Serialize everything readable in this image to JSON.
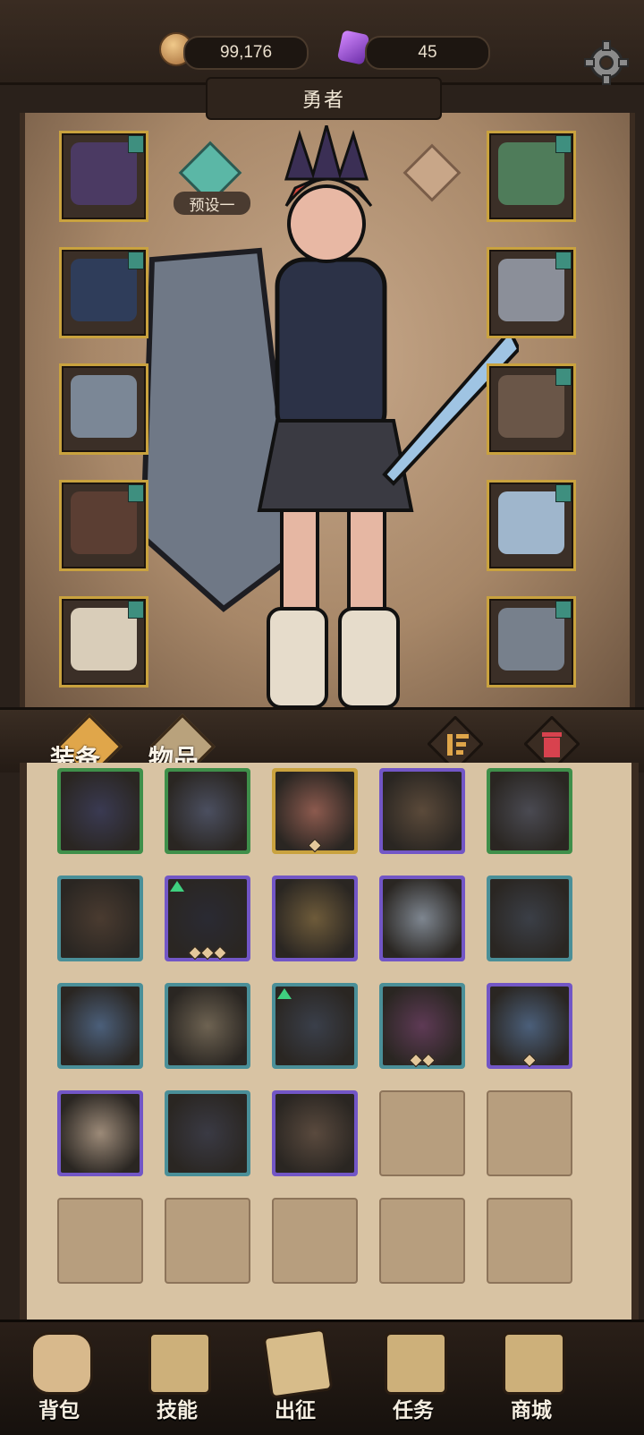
{
  "resources": {
    "gold": {
      "icon": "gold-coin-icon",
      "value": "99,176"
    },
    "gems": {
      "icon": "purple-crystal-icon",
      "value": "45"
    }
  },
  "settings_icon": "gear-icon",
  "character": {
    "name": "勇者",
    "preset_label": "预设一",
    "equip_left": [
      {
        "name": "crown",
        "color": "#4b3a63",
        "tagged": true
      },
      {
        "name": "armor",
        "color": "#2f3d5a",
        "tagged": true
      },
      {
        "name": "gauntlet",
        "color": "#7b8796",
        "tagged": false
      },
      {
        "name": "belt",
        "color": "#5b3e33",
        "tagged": true
      },
      {
        "name": "boots",
        "color": "#d9cdb9",
        "tagged": true
      }
    ],
    "equip_right": [
      {
        "name": "necklace",
        "color": "#4f7c5a",
        "tagged": true
      },
      {
        "name": "ring",
        "color": "#8b8f99",
        "tagged": true
      },
      {
        "name": "orb",
        "color": "#6a5648",
        "tagged": true
      },
      {
        "name": "dagger",
        "color": "#9fb6cc",
        "tagged": true
      },
      {
        "name": "shield",
        "color": "#77808c",
        "tagged": true
      }
    ]
  },
  "tabs": {
    "equipment": "装备",
    "items": "物品"
  },
  "tab_icons": {
    "sort": "sort-icon",
    "trash": "trash-icon"
  },
  "inventory": [
    {
      "rarity": "green",
      "item": "helmet",
      "color": "#3a3a52",
      "upgrade": false,
      "pips": 0
    },
    {
      "rarity": "green",
      "item": "greaves",
      "color": "#4b4f60",
      "upgrade": false,
      "pips": 0
    },
    {
      "rarity": "gold",
      "item": "dagger",
      "color": "#8c5a4e",
      "upgrade": false,
      "pips": 1
    },
    {
      "rarity": "purple",
      "item": "spear-head",
      "color": "#5b4a3a",
      "upgrade": false,
      "pips": 0
    },
    {
      "rarity": "green",
      "item": "ring",
      "color": "#4a4a52",
      "upgrade": false,
      "pips": 0
    },
    {
      "rarity": "teal",
      "item": "amulet",
      "color": "#4a3b30",
      "upgrade": false,
      "pips": 0
    },
    {
      "rarity": "purple",
      "item": "cap",
      "color": "#2a2a33",
      "upgrade": true,
      "pips": 3
    },
    {
      "rarity": "purple",
      "item": "ring-red",
      "color": "#6e5b3a",
      "upgrade": false,
      "pips": 0
    },
    {
      "rarity": "purple",
      "item": "saber",
      "color": "#7e8690",
      "upgrade": false,
      "pips": 0
    },
    {
      "rarity": "teal",
      "item": "cross-necklace",
      "color": "#3b3f47",
      "upgrade": false,
      "pips": 0
    },
    {
      "rarity": "teal",
      "item": "lantern-amulet",
      "color": "#4b5f7a",
      "upgrade": false,
      "pips": 0
    },
    {
      "rarity": "teal",
      "item": "round-shield",
      "color": "#6e6352",
      "upgrade": false,
      "pips": 0
    },
    {
      "rarity": "teal",
      "item": "leg-armor",
      "color": "#3a3f4a",
      "upgrade": true,
      "pips": 0
    },
    {
      "rarity": "teal",
      "item": "curved-blade",
      "color": "#5e3a55",
      "upgrade": false,
      "pips": 2
    },
    {
      "rarity": "purple",
      "item": "lantern-amulet",
      "color": "#4b5f7a",
      "upgrade": false,
      "pips": 1
    },
    {
      "rarity": "purple",
      "item": "bracer",
      "color": "#9c8a78",
      "upgrade": false,
      "pips": 0
    },
    {
      "rarity": "teal",
      "item": "pants",
      "color": "#3a3a44",
      "upgrade": false,
      "pips": 0
    },
    {
      "rarity": "purple",
      "item": "tunic",
      "color": "#5a4a3e",
      "upgrade": false,
      "pips": 0
    },
    {
      "rarity": "empty"
    },
    {
      "rarity": "empty"
    },
    {
      "rarity": "empty"
    },
    {
      "rarity": "empty"
    },
    {
      "rarity": "empty"
    },
    {
      "rarity": "empty"
    },
    {
      "rarity": "empty"
    }
  ],
  "nav": [
    {
      "label": "背包",
      "icon": "backpack-icon"
    },
    {
      "label": "技能",
      "icon": "skill-book-icon"
    },
    {
      "label": "出征",
      "icon": "sword-map-icon"
    },
    {
      "label": "任务",
      "icon": "scroll-icon"
    },
    {
      "label": "商城",
      "icon": "shop-crown-icon"
    }
  ],
  "colors": {
    "rarity": {
      "green": "#3f8f4a",
      "teal": "#4a8f98",
      "purple": "#7256c6",
      "gold": "#c9a23e"
    }
  }
}
